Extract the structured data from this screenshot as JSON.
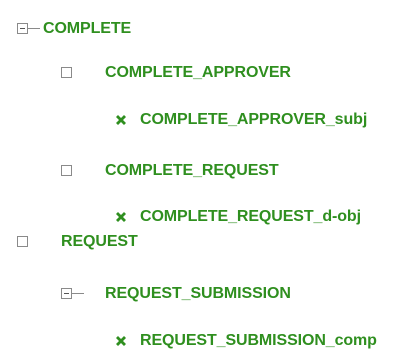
{
  "tree": {
    "nodes": [
      {
        "label": "COMPLETE",
        "state": "expanded"
      },
      {
        "label": "COMPLETE_APPROVER",
        "state": "collapsed"
      },
      {
        "label": "COMPLETE_APPROVER_subj",
        "state": "leaf"
      },
      {
        "label": "COMPLETE_REQUEST",
        "state": "collapsed"
      },
      {
        "label": "COMPLETE_REQUEST_d-obj",
        "state": "leaf"
      },
      {
        "label": "REQUEST",
        "state": "collapsed"
      },
      {
        "label": "REQUEST_SUBMISSION",
        "state": "expanded"
      },
      {
        "label": "REQUEST_SUBMISSION_comp",
        "state": "leaf"
      }
    ]
  },
  "colors": {
    "label": "#2f8f1f",
    "leaf_icon": "#2f8f1f",
    "toggle_border": "#8a8a8a"
  },
  "icons": {
    "expanded": "minus-box-icon",
    "collapsed": "empty-box-icon",
    "leaf": "x-leaf-icon"
  }
}
